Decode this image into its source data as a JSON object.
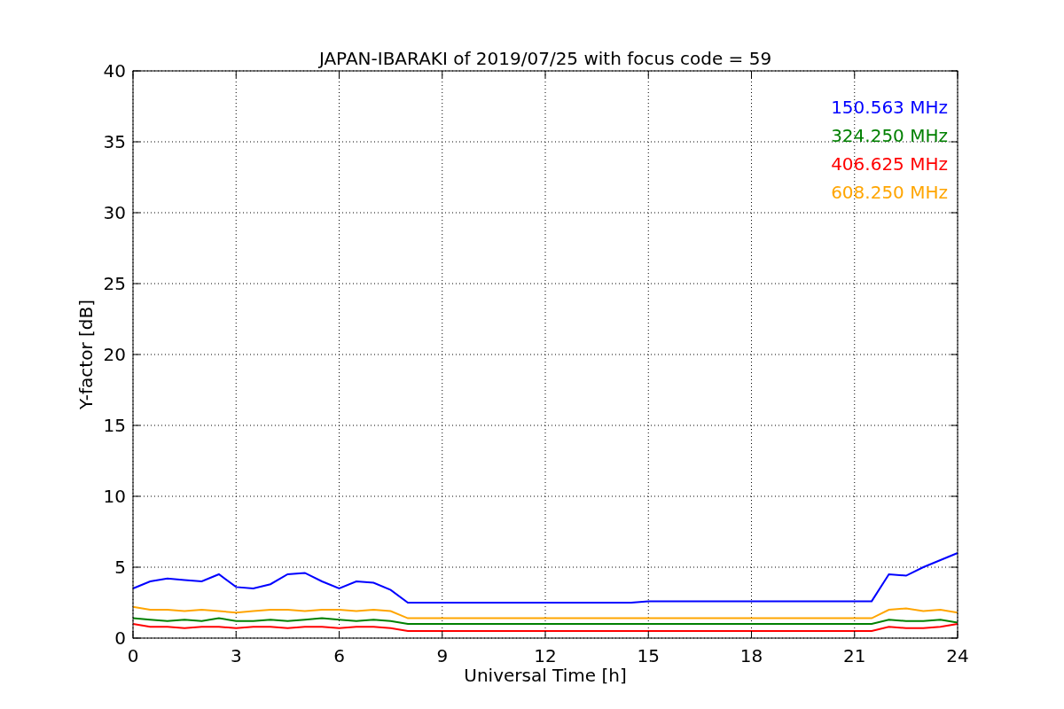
{
  "chart_data": {
    "type": "line",
    "title": "JAPAN-IBARAKI of 2019/07/25 with focus code = 59",
    "xlabel": "Universal Time [h]",
    "ylabel": "Y-factor [dB]",
    "x": [
      0,
      0.5,
      1,
      1.5,
      2,
      2.5,
      3,
      3.5,
      4,
      4.5,
      5,
      5.5,
      6,
      6.5,
      7,
      7.5,
      8,
      8.5,
      9,
      9.5,
      10,
      10.5,
      11,
      11.5,
      12,
      12.5,
      13,
      13.5,
      14,
      14.5,
      15,
      15.5,
      16,
      16.5,
      17,
      17.5,
      18,
      18.5,
      19,
      19.5,
      20,
      20.5,
      21,
      21.5,
      22,
      22.5,
      23,
      23.5,
      24
    ],
    "series": [
      {
        "name": "150.563 MHz",
        "color": "#0000ff",
        "values": [
          3.5,
          4.0,
          4.2,
          4.1,
          4.0,
          4.5,
          3.6,
          3.5,
          3.8,
          4.5,
          4.6,
          4.0,
          3.5,
          4.0,
          3.9,
          3.4,
          2.5,
          2.5,
          2.5,
          2.5,
          2.5,
          2.5,
          2.5,
          2.5,
          2.5,
          2.5,
          2.5,
          2.5,
          2.5,
          2.5,
          2.6,
          2.6,
          2.6,
          2.6,
          2.6,
          2.6,
          2.6,
          2.6,
          2.6,
          2.6,
          2.6,
          2.6,
          2.6,
          2.6,
          4.5,
          4.4,
          5.0,
          5.5,
          6.0
        ]
      },
      {
        "name": "324.250 MHz",
        "color": "#008000",
        "values": [
          1.4,
          1.3,
          1.2,
          1.3,
          1.2,
          1.4,
          1.2,
          1.2,
          1.3,
          1.2,
          1.3,
          1.4,
          1.3,
          1.2,
          1.3,
          1.2,
          1.0,
          1.0,
          1.0,
          1.0,
          1.0,
          1.0,
          1.0,
          1.0,
          1.0,
          1.0,
          1.0,
          1.0,
          1.0,
          1.0,
          1.0,
          1.0,
          1.0,
          1.0,
          1.0,
          1.0,
          1.0,
          1.0,
          1.0,
          1.0,
          1.0,
          1.0,
          1.0,
          1.0,
          1.3,
          1.2,
          1.2,
          1.3,
          1.1
        ]
      },
      {
        "name": "406.625 MHz",
        "color": "#ff0000",
        "values": [
          1.0,
          0.8,
          0.8,
          0.7,
          0.8,
          0.8,
          0.7,
          0.8,
          0.8,
          0.7,
          0.8,
          0.8,
          0.7,
          0.8,
          0.8,
          0.7,
          0.5,
          0.5,
          0.5,
          0.5,
          0.5,
          0.5,
          0.5,
          0.5,
          0.5,
          0.5,
          0.5,
          0.5,
          0.5,
          0.5,
          0.5,
          0.5,
          0.5,
          0.5,
          0.5,
          0.5,
          0.5,
          0.5,
          0.5,
          0.5,
          0.5,
          0.5,
          0.5,
          0.5,
          0.8,
          0.7,
          0.7,
          0.8,
          1.0
        ]
      },
      {
        "name": "608.250 MHz",
        "color": "#ffa500",
        "values": [
          2.2,
          2.0,
          2.0,
          1.9,
          2.0,
          1.9,
          1.8,
          1.9,
          2.0,
          2.0,
          1.9,
          2.0,
          2.0,
          1.9,
          2.0,
          1.9,
          1.4,
          1.4,
          1.4,
          1.4,
          1.4,
          1.4,
          1.4,
          1.4,
          1.4,
          1.4,
          1.4,
          1.4,
          1.4,
          1.4,
          1.4,
          1.4,
          1.4,
          1.4,
          1.4,
          1.4,
          1.4,
          1.4,
          1.4,
          1.4,
          1.4,
          1.4,
          1.4,
          1.4,
          2.0,
          2.1,
          1.9,
          2.0,
          1.8
        ]
      }
    ],
    "xlim": [
      0,
      24
    ],
    "ylim": [
      0,
      40
    ],
    "grid": true,
    "xticks": [
      0,
      3,
      6,
      9,
      12,
      15,
      18,
      21,
      24
    ],
    "yticks": [
      0,
      5,
      10,
      15,
      20,
      25,
      30,
      35,
      40
    ]
  }
}
